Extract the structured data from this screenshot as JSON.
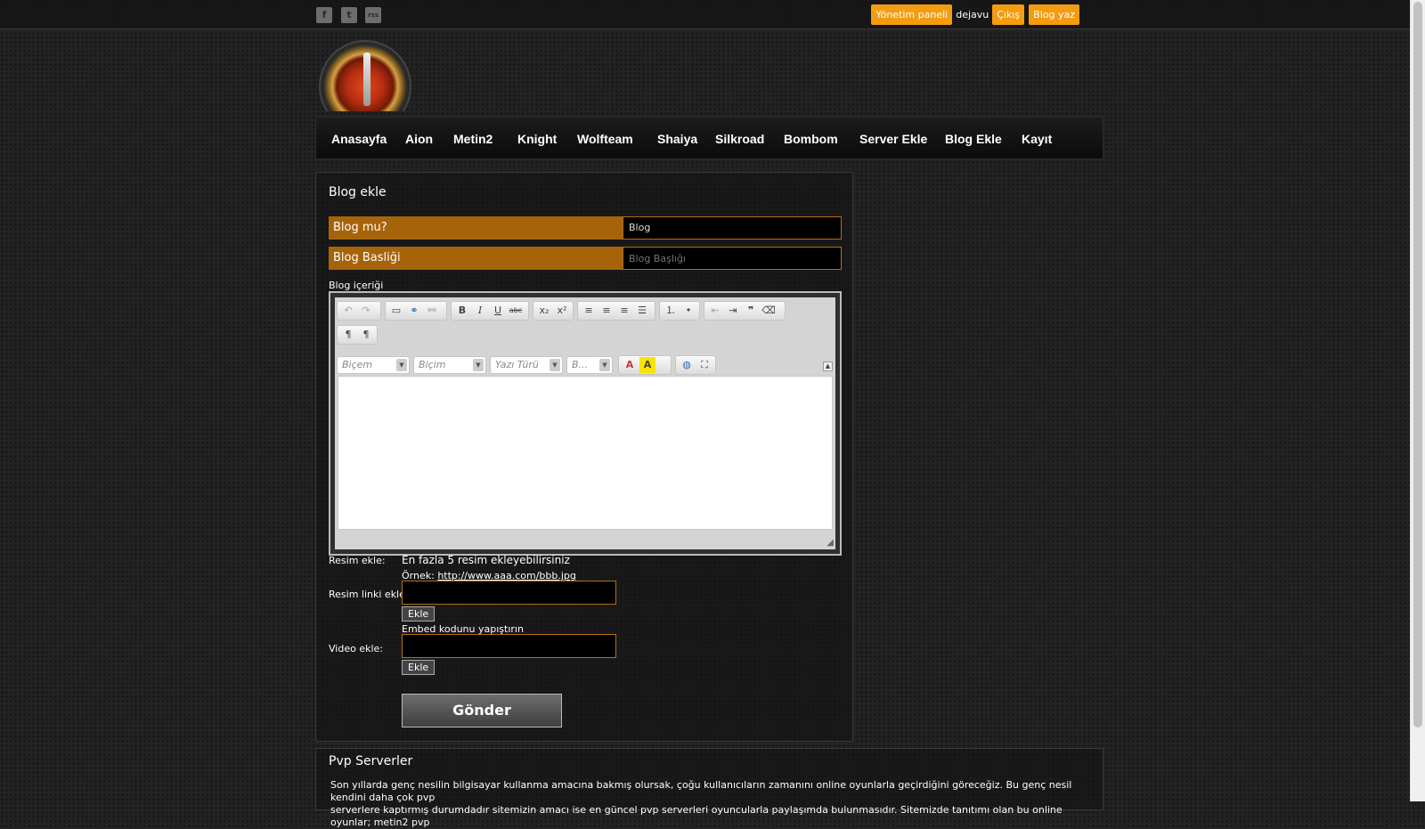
{
  "social": {
    "facebook": "f",
    "twitter": "t",
    "rss": "rss"
  },
  "userbar": {
    "panel": "Yönetim paneli",
    "username": "dejavu",
    "logout": "Çıkış",
    "write_blog": "Blog yaz"
  },
  "nav": [
    "Anasayfa",
    "Aion",
    "Metin2",
    "Knight",
    "Wolfteam",
    "Shaiya",
    "Silkroad",
    "Bombom",
    "Server Ekle",
    "Blog Ekle",
    "Kayıt"
  ],
  "form": {
    "title": "Blog ekle",
    "type_label": "Blog mu?",
    "type_value": "Blog",
    "heading_label": "Blog Basliği",
    "heading_placeholder": "Blog Başlığı",
    "content_label": "Blog içeriği",
    "image_label": "Resim ekle:",
    "image_note": "En fazla 5 resim ekleyebilirsiniz",
    "example_prefix": "Örnek:",
    "example_link": "http://www.aaa.com/bbb.jpg",
    "image_link_label": "Resim linki ekle:",
    "add": "Ekle",
    "embed_note": "Embed kodunu yapıştırın",
    "video_label": "Video ekle:",
    "submit": "Gönder"
  },
  "editor": {
    "style_combo": "Biçem",
    "format_combo": "Biçim",
    "font_combo": "Yazı Türü",
    "size_combo": "B..."
  },
  "pvp": {
    "title": "Pvp Serverler",
    "text_line1": "Son yıllarda genç nesilin bilgisayar kullanma amacına bakmış olursak, çoğu kullanıcıların zamanını online oyunlarla geçirdiğini göreceğiz. Bu genç nesil kendini daha çok pvp",
    "text_line2": "serverlere kaptırmış durumdadır sitemizin amacı ise en güncel pvp serverleri oyuncularla paylaşımda bulunmasıdır. Sitemizde tanıtımı olan bu online oyunlar; metin2 pvp"
  }
}
